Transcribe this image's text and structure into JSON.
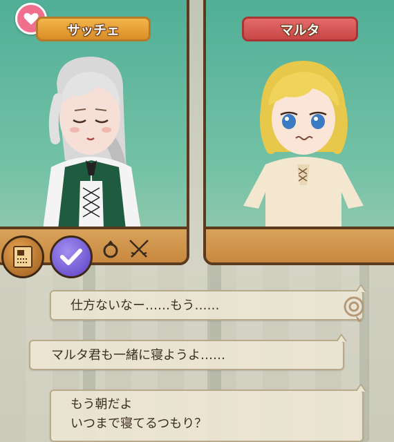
{
  "characters": {
    "left": {
      "name": "サッチェ"
    },
    "right": {
      "name": "マルタ"
    }
  },
  "icons": {
    "favorite": "heart-icon",
    "book": "book-menu-icon",
    "confirm": "check-icon",
    "ring": "ring-icon",
    "battle": "crossed-swords-icon",
    "skip": "fast-forward-icon"
  },
  "dialogue": [
    {
      "lines": [
        "仕方ないなー……もう……"
      ]
    },
    {
      "lines": [
        "マルタ君も一緒に寝ようよ……"
      ]
    },
    {
      "lines": [
        "もう朝だよ",
        "いつまで寝てるつもり？"
      ]
    }
  ],
  "colors": {
    "panel_green": "#5fb79d",
    "frame_brown": "#5b3a1e",
    "left_plate": "#e9a23b",
    "right_plate": "#d65a5a",
    "heart_badge": "#ef6f8c",
    "bubble": "#ece5d2"
  }
}
